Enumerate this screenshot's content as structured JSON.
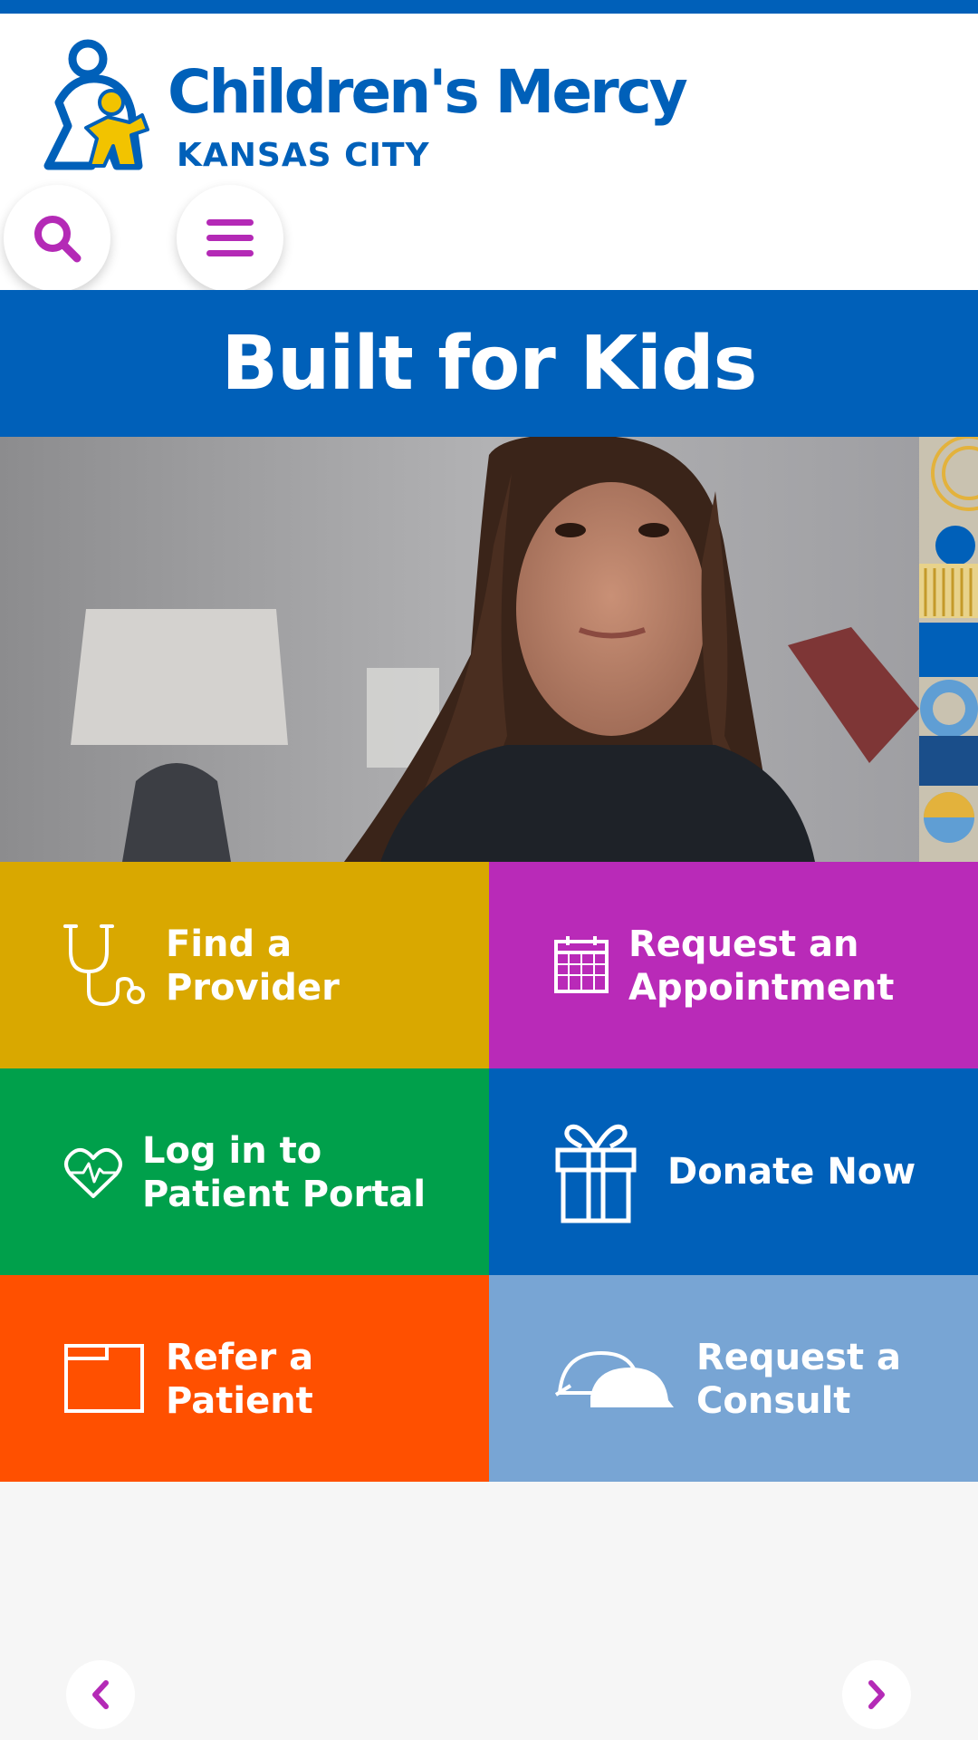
{
  "brand": {
    "name": "Children's Mercy",
    "location": "KANSAS CITY",
    "primary_color": "#0060b9",
    "accent_color": "#b42ab6"
  },
  "header": {
    "search_icon": "search-icon",
    "menu_icon": "hamburger-menu-icon"
  },
  "banner": {
    "title": "Built for Kids"
  },
  "hero": {
    "image": "photo of smiling girl with long dark hair, lamp in background, geometric pattern at right edge"
  },
  "quick_links": [
    {
      "line1": "Find a",
      "line2": "Provider",
      "icon": "stethoscope-icon",
      "color": "#d9a800"
    },
    {
      "line1": "Request an",
      "line2": "Appointment",
      "icon": "calendar-icon",
      "color": "#b92ab8"
    },
    {
      "line1": "Log in to",
      "line2": "Patient Portal",
      "icon": "heart-pulse-icon",
      "color": "#00a04b"
    },
    {
      "line1": "Donate Now",
      "line2": "",
      "icon": "gift-icon",
      "color": "#0060b9"
    },
    {
      "line1": "Refer a",
      "line2": "Patient",
      "icon": "folder-icon",
      "color": "#ff5000"
    },
    {
      "line1": "Request a",
      "line2": "Consult",
      "icon": "chat-bubbles-icon",
      "color": "#78a5d4"
    }
  ],
  "carousel": {
    "prev_icon": "chevron-left-icon",
    "next_icon": "chevron-right-icon"
  }
}
